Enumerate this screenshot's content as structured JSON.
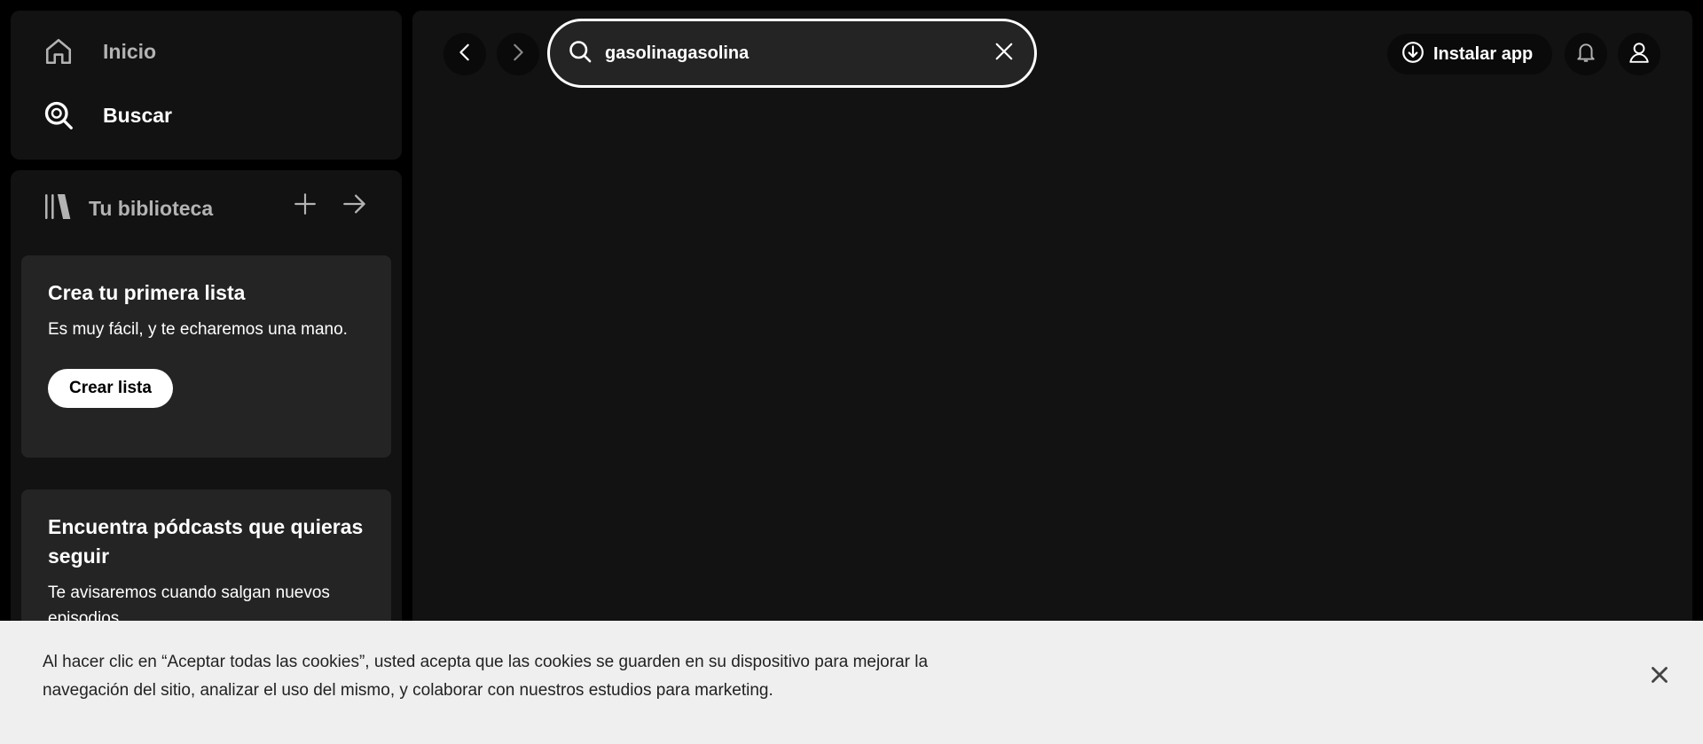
{
  "sidebar": {
    "nav": [
      {
        "label": "Inicio",
        "icon": "home-icon",
        "active": false
      },
      {
        "label": "Buscar",
        "icon": "search-icon",
        "active": true
      }
    ],
    "library": {
      "label": "Tu biblioteca",
      "icon": "library-icon",
      "actions": [
        "plus-icon",
        "arrow-right-icon"
      ]
    },
    "cards": [
      {
        "title": "Crea tu primera lista",
        "text": "Es muy fácil, y te echaremos una mano.",
        "button": "Crear lista"
      },
      {
        "title": "Encuentra pódcasts que quieras seguir",
        "text": "Te avisaremos cuando salgan nuevos episodios."
      }
    ]
  },
  "topbar": {
    "search_value": "gasolinagasolina",
    "install_label": "Instalar app"
  },
  "cookie_banner": {
    "text": "Al hacer clic en “Aceptar todas las cookies”, usted acepta que las cookies se guarden en su dispositivo para mejorar la navegación del sitio, analizar el uso del mismo, y colaborar con nuestros estudios para marketing."
  },
  "colors": {
    "background": "#000000",
    "panel": "#121212",
    "card": "#242424",
    "text_muted": "#b3b3b3",
    "banner": "#efefef"
  }
}
